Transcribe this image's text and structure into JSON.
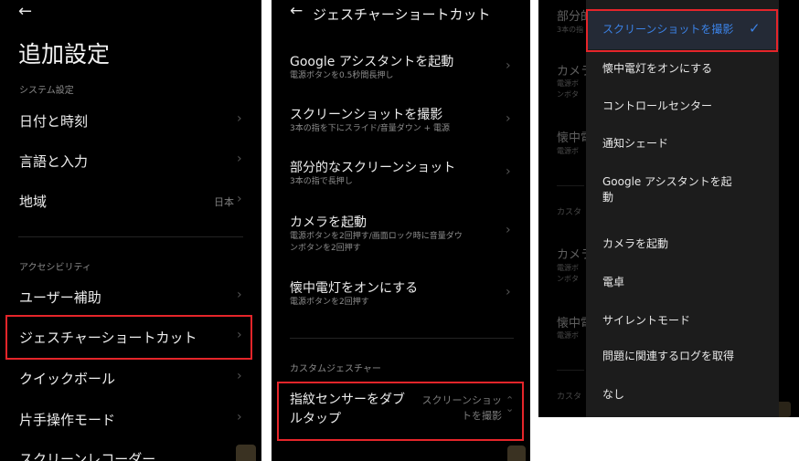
{
  "panel1": {
    "back_icon": "arrow-left-icon",
    "title": "追加設定",
    "section_system": "システム設定",
    "row_datetime": "日付と時刻",
    "row_language": "言語と入力",
    "row_region": "地域",
    "row_region_value": "日本",
    "section_accessibility": "アクセシビリティ",
    "row_assist": "ユーザー補助",
    "row_gesture": "ジェスチャーショートカット",
    "row_quickball": "クイックボール",
    "row_onehand": "片手操作モード",
    "row_recorder": "スクリーンレコーダー"
  },
  "panel2": {
    "title": "ジェスチャーショートカット",
    "items": [
      {
        "title": "Google アシスタントを起動",
        "sub": "電源ボタンを0.5秒間長押し"
      },
      {
        "title": "スクリーンショットを撮影",
        "sub": "3本の指を下にスライド/音量ダウン + 電源"
      },
      {
        "title": "部分的なスクリーンショット",
        "sub": "3本の指で長押し"
      },
      {
        "title": "カメラを起動",
        "sub1": "電源ボタンを2回押す/画面ロック時に音量ダウ",
        "sub2": "ンボタンを2回押す"
      },
      {
        "title": "懐中電灯をオンにする",
        "sub": "電源ボタンを2回押す"
      }
    ],
    "section_custom": "カスタムジェスチャー",
    "custom_title1": "指紋センサーをダブ",
    "custom_title2": "ルタップ",
    "custom_value1": "スクリーンショッ",
    "custom_value2": "トを撮影"
  },
  "panel3": {
    "bg": {
      "t1": "部分的",
      "s1": "3本の指",
      "t2": "カメラ",
      "s2a": "電源ボ",
      "s2b": "ンボタ",
      "t3": "懐中電",
      "s3": "電源ボ",
      "section": "カスタ",
      "t4": "カメラ",
      "s4a": "電源ボ",
      "s4b": "ンボタ",
      "t5": "懐中電",
      "s5": "電源ボ",
      "section2": "カスタ"
    },
    "options": [
      "スクリーンショットを撮影",
      "懐中電灯をオンにする",
      "コントロールセンター",
      "通知シェード",
      "Google アシスタントを起",
      "動",
      "カメラを起動",
      "電卓",
      "サイレントモード",
      "問題に関連するログを取得",
      "なし"
    ],
    "selected_icon": "checkmark-icon"
  },
  "colors": {
    "highlight": "#e5252a",
    "accent": "#3b82e6",
    "background": "#000000"
  }
}
